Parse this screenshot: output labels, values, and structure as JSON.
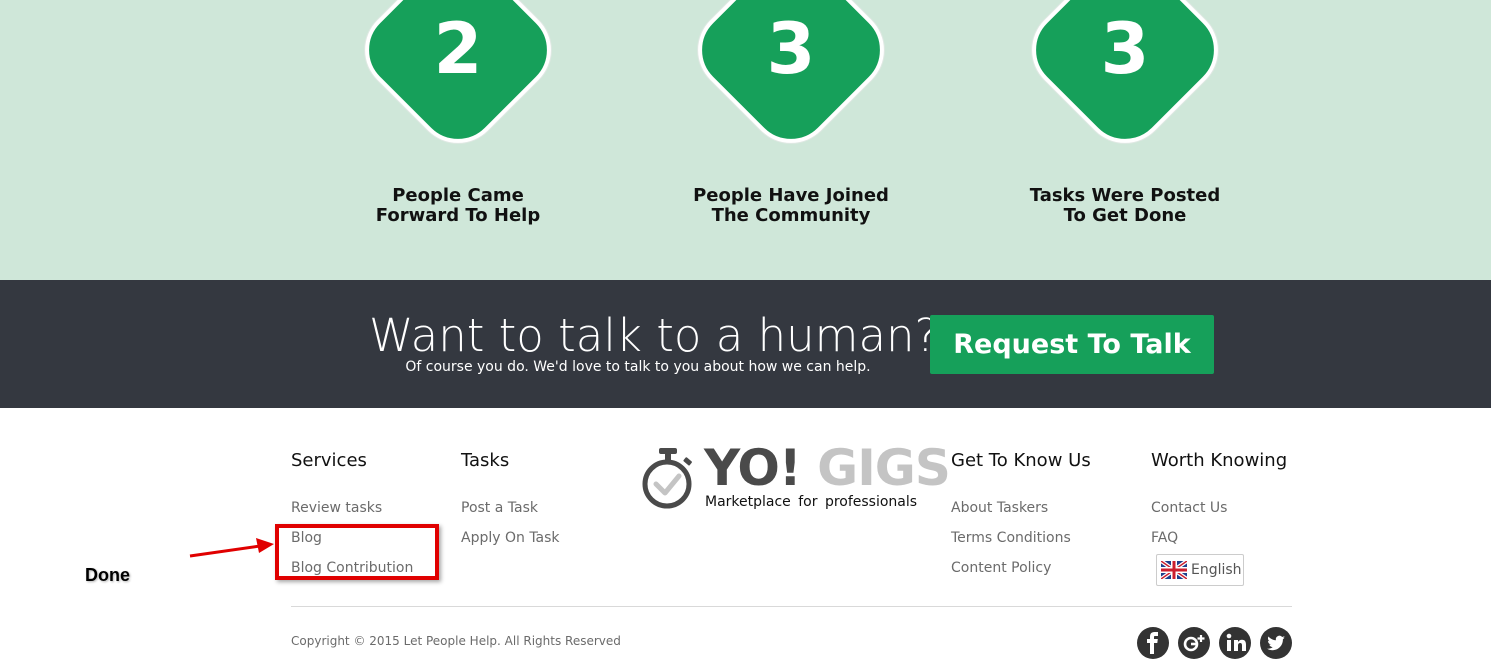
{
  "stats": [
    {
      "number": "2",
      "line1": "People Came",
      "line2": "Forward To Help"
    },
    {
      "number": "3",
      "line1": "People Have Joined",
      "line2": "The Community"
    },
    {
      "number": "3",
      "line1": "Tasks Were Posted",
      "line2": "To Get Done"
    }
  ],
  "talk": {
    "title": "Want to talk to a human?",
    "subtitle": "Of course you do. We'd love to talk to you about how we can help.",
    "button": "Request To Talk"
  },
  "footer": {
    "services": {
      "title": "Services",
      "links": [
        "Review tasks",
        "Blog",
        "Blog Contribution"
      ]
    },
    "tasks": {
      "title": "Tasks",
      "links": [
        "Post a Task",
        "Apply On Task"
      ]
    },
    "logo": {
      "brand_a": "YO!",
      "brand_b": "GIGS",
      "tagline": "Marketplace for professionals"
    },
    "know_us": {
      "title": "Get To Know Us",
      "links": [
        "About Taskers",
        "Terms Conditions",
        "Content Policy"
      ]
    },
    "worth": {
      "title": "Worth Knowing",
      "links": [
        "Contact Us",
        "FAQ"
      ],
      "language": "English"
    },
    "copyright": "Copyright © 2015 Let People Help. All Rights Reserved",
    "social": [
      "facebook-icon",
      "google-plus-icon",
      "linkedin-icon",
      "twitter-icon"
    ]
  },
  "annotation": {
    "text": "Done"
  },
  "colors": {
    "green": "#16a05a",
    "mint": "#cfe7d9",
    "dark": "#343840",
    "annotation_red": "#e00000"
  }
}
